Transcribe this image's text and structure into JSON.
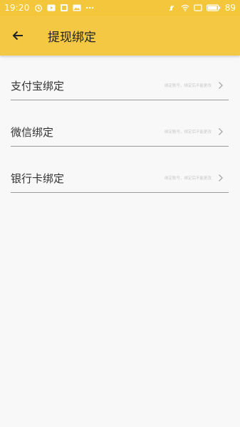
{
  "status_bar": {
    "time": "19:20",
    "battery": "89",
    "left_icons": [
      "alarm-icon",
      "play-icon",
      "app-icon",
      "image-icon",
      "more-dots-icon"
    ],
    "right_icons": [
      "mute-icon",
      "wifi-icon",
      "screen-icon",
      "battery-icon"
    ]
  },
  "app_bar": {
    "back_icon": "arrow-left-icon",
    "title": "提现绑定"
  },
  "bindings": [
    {
      "label": "支付宝绑定",
      "hint": "绑定账号，绑定后不能更改"
    },
    {
      "label": "微信绑定",
      "hint": "绑定账号，绑定后不能更改"
    },
    {
      "label": "银行卡绑定",
      "hint": "绑定账号，绑定后不能更改"
    }
  ],
  "colors": {
    "status_bar": "#f3c63b",
    "app_bar": "#f5c843",
    "background": "#f8f8f8",
    "divider": "#9a9a9a"
  }
}
